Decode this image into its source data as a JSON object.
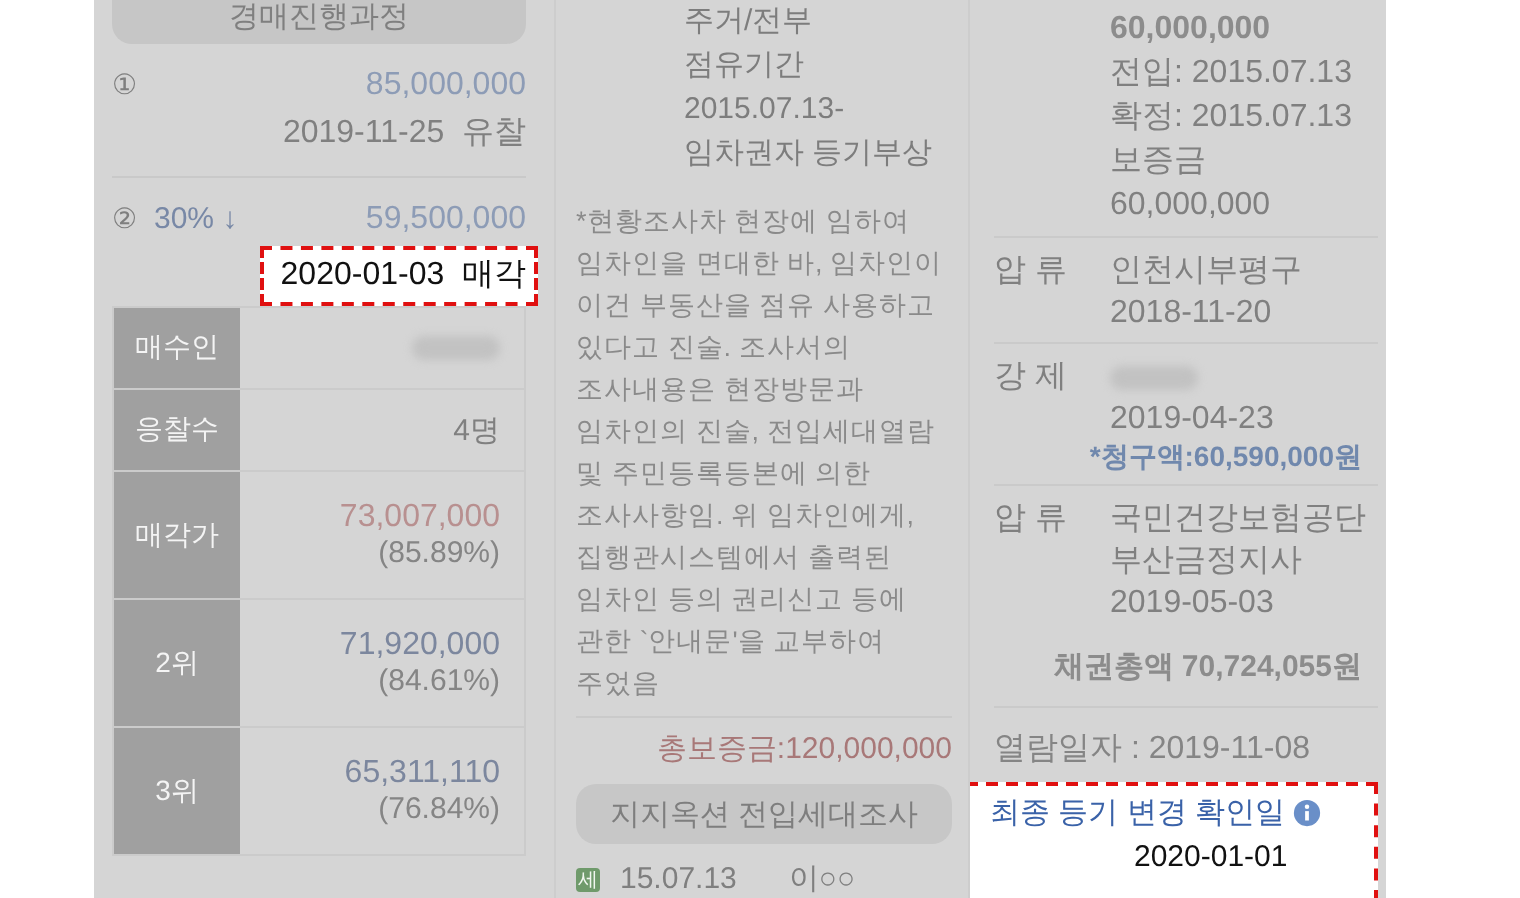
{
  "auction_progress": {
    "title": "경매진행과정",
    "rounds": [
      {
        "number": "①",
        "price": "85,000,000",
        "date": "2019-11-25",
        "result": "유찰",
        "highlighted": false
      },
      {
        "number": "②",
        "discount": "30% ↓",
        "price": "59,500,000",
        "date": "2020-01-03",
        "result": "매각",
        "highlighted": true
      }
    ]
  },
  "sale_table": [
    {
      "label": "매수인",
      "kind": "blurred"
    },
    {
      "label": "응찰수",
      "kind": "count",
      "value": "4명"
    },
    {
      "label": "매각가",
      "kind": "sale",
      "value": "73,007,000",
      "sub": "(85.89%)"
    },
    {
      "label": "2위",
      "kind": "bid",
      "value": "71,920,000",
      "sub": "(84.61%)"
    },
    {
      "label": "3위",
      "kind": "bid",
      "value": "65,311,110",
      "sub": "(76.84%)"
    }
  ],
  "occupancy": {
    "lines": [
      "주거/전부",
      "점유기간",
      "2015.07.13-",
      "임차권자 등기부상"
    ],
    "note": "*현황조사차 현장에 임하여 임차인을 면대한 바, 임차인이 이건 부동산을 점유 사용하고 있다고 진술. 조사서의 조사내용은 현장방문과 임차인의 진술, 전입세대열람 및 주민등록등본에 의한 조사사항임. 위 임차인에게, 집행관시스템에서 출력된 임차인 등의 권리신고 등에 관한 `안내문'을 교부하여 주었음",
    "total_deposit": "총보증금:120,000,000",
    "survey_button": "지지옥션 전입세대조사",
    "households": [
      {
        "badge": "세",
        "date": "15.07.13",
        "name": "이○○"
      }
    ]
  },
  "registry": {
    "tenant_lines": [
      {
        "text": "60,000,000",
        "bold": true
      },
      {
        "text": "전입: 2015.07.13",
        "bold": false
      },
      {
        "text": "확정: 2015.07.13",
        "bold": false
      },
      {
        "text": "보증금",
        "bold": false
      },
      {
        "text": "60,000,000",
        "bold": false
      }
    ],
    "entries": [
      {
        "type": "압 류",
        "lines": [
          {
            "kind": "text",
            "text": "인천시부평구"
          },
          {
            "kind": "text",
            "text": "2018-11-20"
          }
        ]
      },
      {
        "type": "강 제",
        "lines": [
          {
            "kind": "blurred"
          },
          {
            "kind": "text",
            "text": "2019-04-23"
          }
        ],
        "claim": "*청구액:60,590,000원"
      },
      {
        "type": "압 류",
        "lines": [
          {
            "kind": "text",
            "text": "국민건강보험공단"
          },
          {
            "kind": "text",
            "text": "부산금정지사"
          },
          {
            "kind": "text",
            "text": "2019-05-03"
          }
        ]
      }
    ],
    "total": "채권총액 70,724,055원",
    "view_date": "열람일자 : 2019-11-08",
    "last_change": {
      "label": "최종 등기 변경 확인일",
      "date": "2020-01-01",
      "highlighted": true
    }
  }
}
